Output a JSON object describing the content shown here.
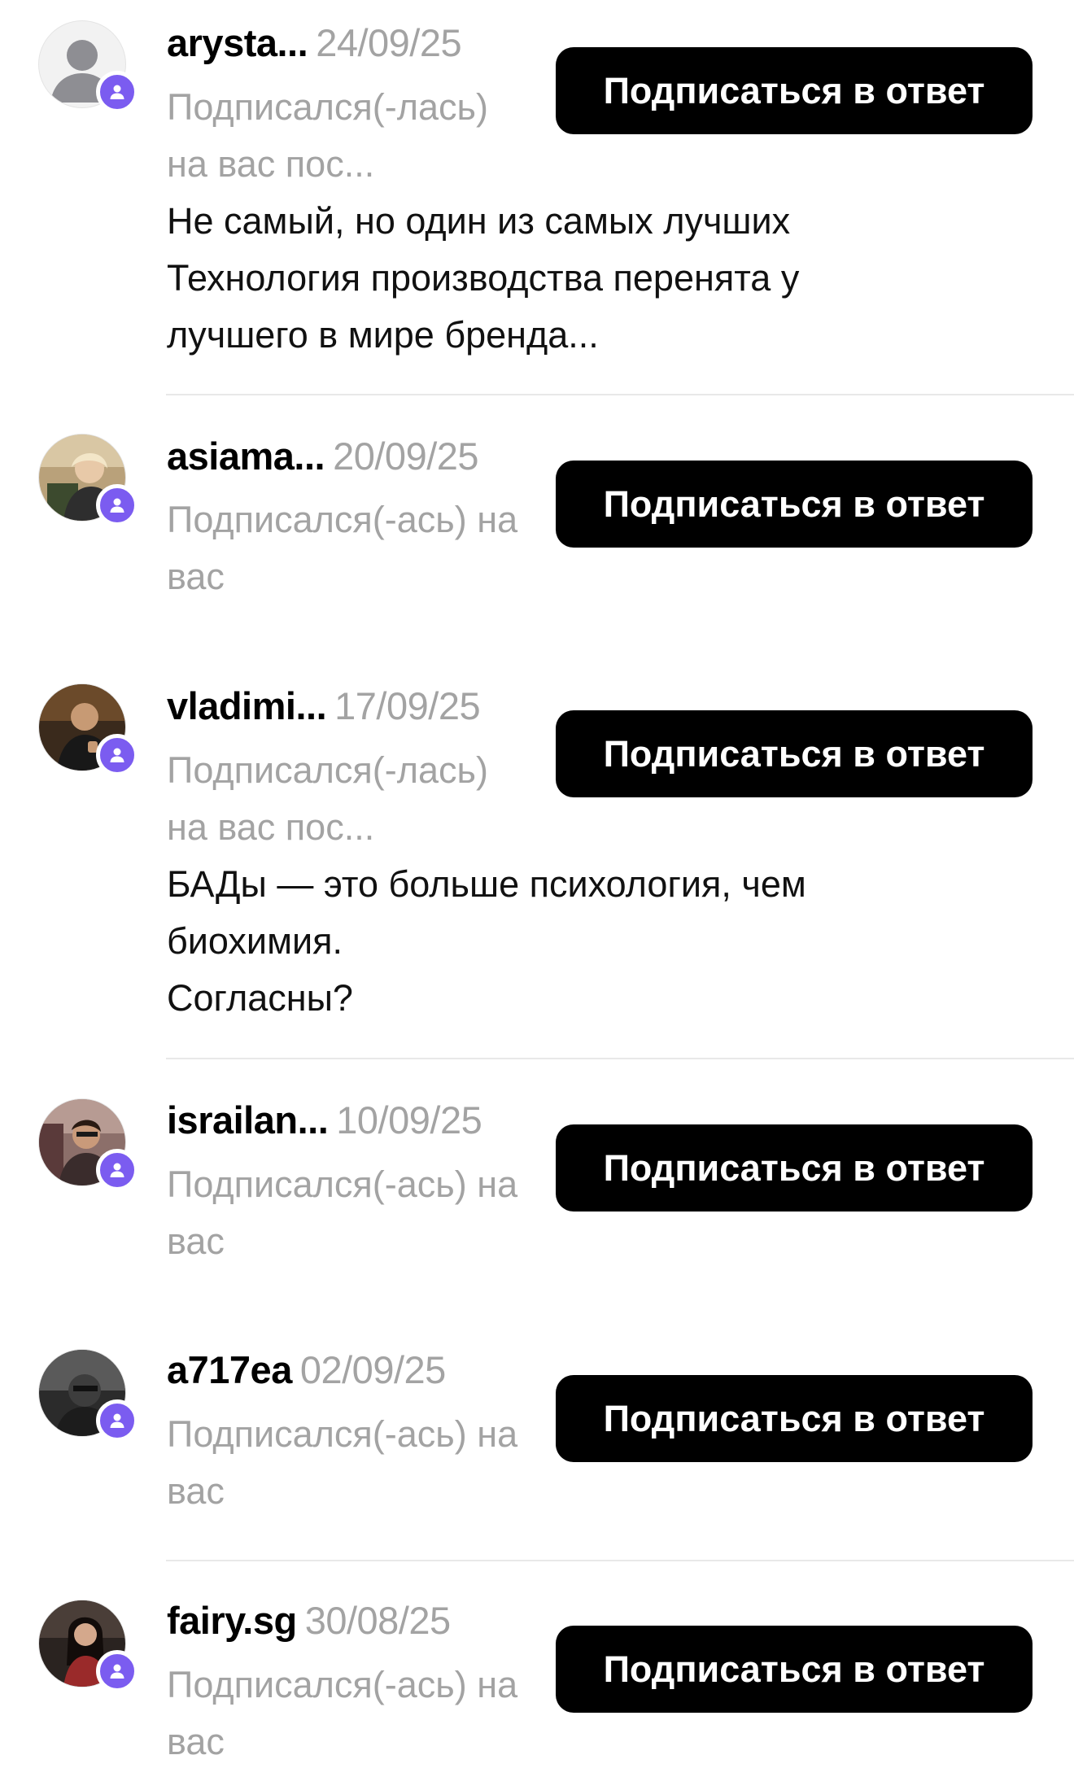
{
  "notifications": [
    {
      "username": "arysta...",
      "date": "24/09/25",
      "subtitle": "Подписался(-лась) на вас пос...",
      "message": "Не самый, но один из самых лучших\nТехнология производства перенята у\nлучшего в мире бренда...",
      "button": "Подписаться в ответ",
      "avatar": "default-avatar"
    },
    {
      "username": "asiama...",
      "date": "20/09/25",
      "subtitle": "Подписался(-ась) на вас",
      "message": "",
      "button": "Подписаться в ответ",
      "avatar": "photo-avatar"
    },
    {
      "username": "vladimi...",
      "date": "17/09/25",
      "subtitle": "Подписался(-лась) на вас пос...",
      "message": "БАДы — это больше психология, чем\nбиохимия.\nСогласны?",
      "button": "Подписаться в ответ",
      "avatar": "photo-avatar"
    },
    {
      "username": "israilan...",
      "date": "10/09/25",
      "subtitle": "Подписался(-ась) на вас",
      "message": "",
      "button": "Подписаться в ответ",
      "avatar": "photo-avatar"
    },
    {
      "username": "a717ea",
      "date": "02/09/25",
      "subtitle": "Подписался(-ась) на вас",
      "message": "",
      "button": "Подписаться в ответ",
      "avatar": "photo-avatar"
    },
    {
      "username": "fairy.sg",
      "date": "30/08/25",
      "subtitle": "Подписался(-ась) на вас",
      "message": "",
      "button": "Подписаться в ответ",
      "avatar": "photo-avatar"
    }
  ],
  "colors": {
    "badge": "#7b5cf0",
    "button_bg": "#000000",
    "button_text": "#ffffff",
    "secondary_text": "#a3a3a3",
    "divider": "#e8e8e8"
  },
  "icons": {
    "badge": "person-icon"
  }
}
